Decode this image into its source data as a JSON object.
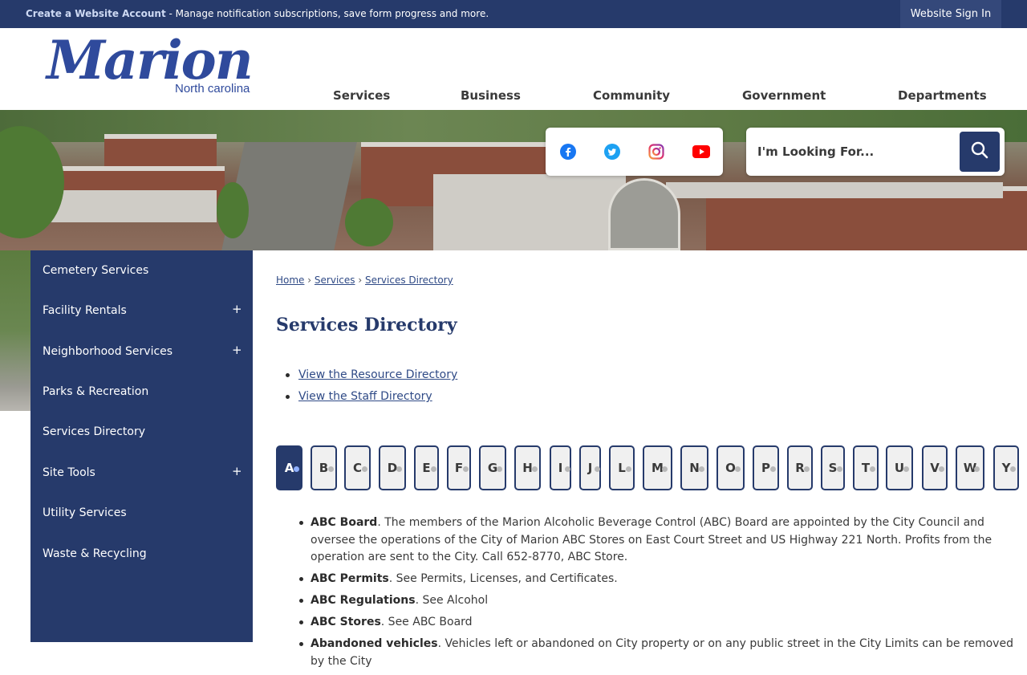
{
  "topbar": {
    "create_account": "Create a Website Account",
    "message": " - Manage notification subscriptions, save form progress and more.",
    "sign_in": "Website Sign In"
  },
  "logo": {
    "word": "Marion",
    "sub": "North carolina"
  },
  "nav": [
    "Services",
    "Business",
    "Community",
    "Government",
    "Departments"
  ],
  "social": [
    "facebook-icon",
    "twitter-icon",
    "instagram-icon",
    "youtube-icon"
  ],
  "search": {
    "placeholder": "I'm Looking For..."
  },
  "sidebar": {
    "items": [
      {
        "label": "Cemetery Services",
        "expandable": false
      },
      {
        "label": "Facility Rentals",
        "expandable": true
      },
      {
        "label": "Neighborhood Services",
        "expandable": true
      },
      {
        "label": "Parks & Recreation",
        "expandable": false
      },
      {
        "label": "Services Directory",
        "expandable": false
      },
      {
        "label": "Site Tools",
        "expandable": true
      },
      {
        "label": "Utility Services",
        "expandable": false
      },
      {
        "label": "Waste & Recycling",
        "expandable": false
      }
    ],
    "plus_symbol": "+"
  },
  "breadcrumb": {
    "home": "Home",
    "sep": "›",
    "services": "Services",
    "current": "Services Directory"
  },
  "page_title": "Services Directory",
  "links": [
    "View the Resource Directory",
    "View the Staff Directory"
  ],
  "letters": [
    "A",
    "B",
    "C",
    "D",
    "E",
    "F",
    "G",
    "H",
    "I",
    "J",
    "L",
    "M",
    "N",
    "O",
    "P",
    "R",
    "S",
    "T",
    "U",
    "V",
    "W",
    "Y"
  ],
  "active_letter": "A",
  "entries": [
    {
      "term": "ABC Board",
      "text": ". The members of the Marion Alcoholic Beverage Control (ABC) Board are appointed by the City Council and oversee the operations of the City of Marion ABC Stores on East Court Street and US Highway 221 North. Profits from the operation are sent to the City. Call 652-8770, ABC Store."
    },
    {
      "term": "ABC Permits",
      "text": ". See Permits, Licenses, and Certificates."
    },
    {
      "term": "ABC Regulations",
      "text": ". See Alcohol"
    },
    {
      "term": "ABC Stores",
      "text": ". See ABC Board"
    },
    {
      "term": "Abandoned vehicles",
      "text": ". Vehicles left or abandoned on City property or on any public street in the City Limits can be removed by the City"
    }
  ],
  "colors": {
    "navy": "#263a6b",
    "link": "#2f4a86"
  }
}
